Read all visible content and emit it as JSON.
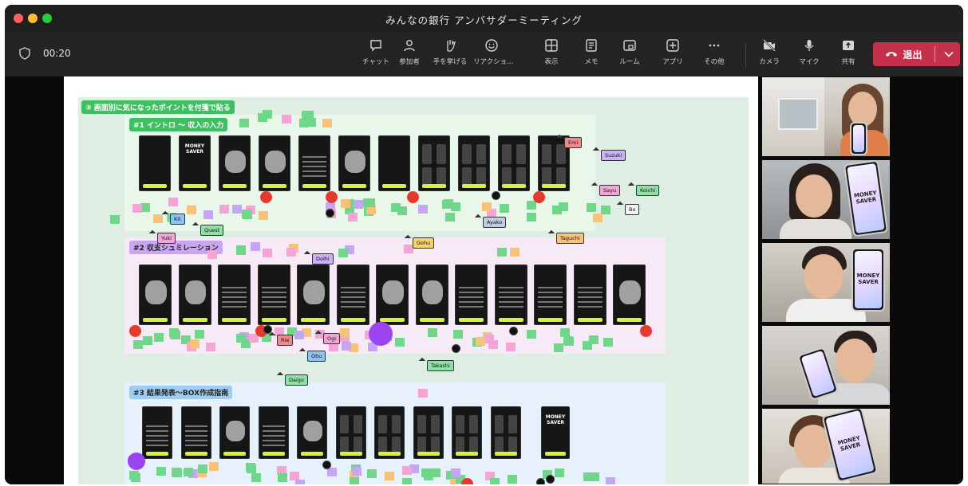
{
  "window": {
    "title": "みんなの銀行 アンバサダーミーティング"
  },
  "toolbar": {
    "timer": "00:20",
    "buttons": [
      {
        "label": "チャット",
        "icon": "chat-icon"
      },
      {
        "label": "参加者",
        "icon": "people-icon"
      },
      {
        "label": "手を挙げる",
        "icon": "raise-hand-icon"
      },
      {
        "label": "リアクショ...",
        "icon": "reaction-icon"
      },
      {
        "label": "表示",
        "icon": "view-icon"
      },
      {
        "label": "メモ",
        "icon": "notes-icon"
      },
      {
        "label": "ルーム",
        "icon": "rooms-icon"
      },
      {
        "label": "アプリ",
        "icon": "apps-icon"
      },
      {
        "label": "その他",
        "icon": "more-icon"
      },
      {
        "label": "カメラ",
        "icon": "camera-off-icon"
      },
      {
        "label": "マイク",
        "icon": "mic-icon"
      },
      {
        "label": "共有",
        "icon": "share-icon"
      }
    ],
    "leave_label": "退出"
  },
  "board": {
    "heading": "③ 画面別に気になったポイントを付箋で貼る",
    "sections": [
      {
        "title": "#1 イントロ 〜 収入の入力"
      },
      {
        "title": "#2 収支シュミレーション"
      },
      {
        "title": "#3 結果発表〜BOX作成指南"
      }
    ],
    "frame_title": "MONEY SAVER",
    "cursors": [
      {
        "name": "Emi",
        "color": "#f08a8a"
      },
      {
        "name": "Suzuki",
        "color": "#c9b3f5"
      },
      {
        "name": "Sayu",
        "color": "#f3a5d6"
      },
      {
        "name": "Koichi",
        "color": "#8fe0a6"
      },
      {
        "name": "Bo",
        "color": "#f2f2f2"
      },
      {
        "name": "Kit",
        "color": "#8dc2f5"
      },
      {
        "name": "Quest",
        "color": "#8fe0a6"
      },
      {
        "name": "Yuki",
        "color": "#f3a5d6"
      },
      {
        "name": "Ayako",
        "color": "#c5cbe0"
      },
      {
        "name": "Taguchi",
        "color": "#f7c27a"
      },
      {
        "name": "Gohu",
        "color": "#f7d36b"
      },
      {
        "name": "Dolhi",
        "color": "#c9b3f5"
      },
      {
        "name": "Rie",
        "color": "#f08a8a"
      },
      {
        "name": "Ogi",
        "color": "#f3a5d6"
      },
      {
        "name": "Obu",
        "color": "#8dc2f5"
      },
      {
        "name": "Takashi",
        "color": "#8fe0a6"
      },
      {
        "name": "Daigo",
        "color": "#8fe0a6"
      }
    ]
  },
  "participants": [
    {
      "name": "",
      "phone_text": ""
    },
    {
      "name": "",
      "phone_text": "MONEY SAVER"
    },
    {
      "name": "",
      "phone_text": "MONEY SAVER"
    },
    {
      "name": "",
      "phone_text": ""
    },
    {
      "name": "",
      "phone_text": "MONEY SAVER"
    }
  ],
  "colors": {
    "leave": "#c4314b",
    "accent_yellow": "#d8f23a",
    "sticky_green": "#6fd68a",
    "sticky_pink": "#f3a5d6",
    "sticky_purple": "#c4a6f5"
  }
}
